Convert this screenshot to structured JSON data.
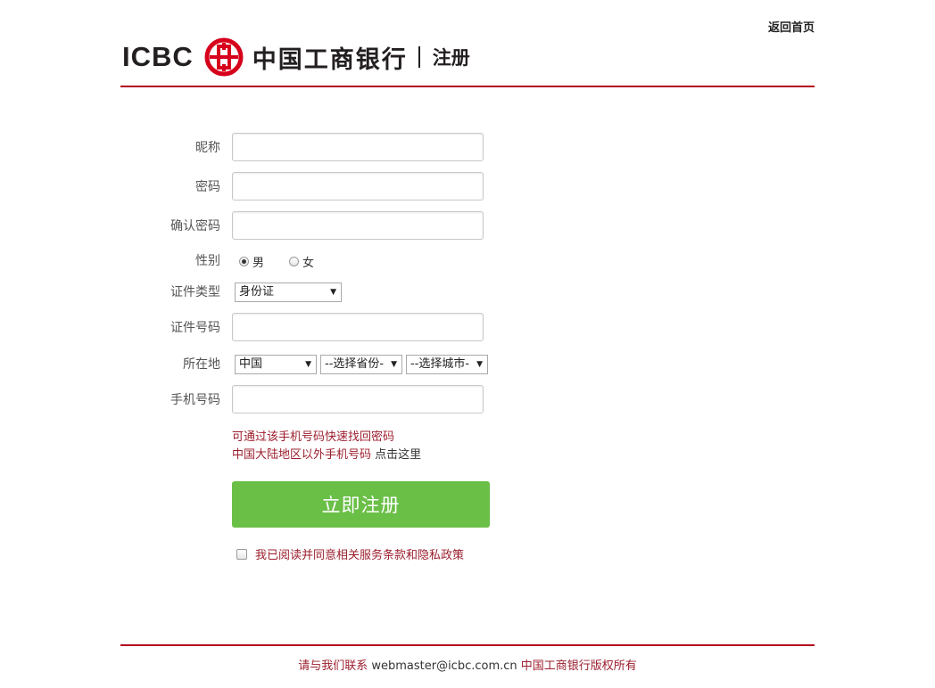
{
  "header": {
    "logo_en": "ICBC",
    "logo_cn": "中国工商银行",
    "page_title": "注册",
    "home_link": "返回首页",
    "brand_color": "#b3001b"
  },
  "form": {
    "nickname": {
      "label": "昵称",
      "value": ""
    },
    "password": {
      "label": "密码",
      "value": ""
    },
    "confirm_password": {
      "label": "确认密码",
      "value": ""
    },
    "gender": {
      "label": "性别",
      "options": [
        {
          "label": "男",
          "checked": true
        },
        {
          "label": "女",
          "checked": false
        }
      ]
    },
    "id_type": {
      "label": "证件类型",
      "selected": "身份证"
    },
    "id_number": {
      "label": "证件号码",
      "value": ""
    },
    "location": {
      "label": "所在地",
      "country": "中国",
      "province": "--选择省份-",
      "city": "--选择城市-"
    },
    "phone": {
      "label": "手机号码",
      "value": ""
    },
    "hint_line1": "可通过该手机号码快速找回密码",
    "hint_line2": "中国大陆地区以外手机号码",
    "hint_link": "点击这里",
    "submit_label": "立即注册",
    "submit_color": "#6abf47",
    "agree_label": "我已阅读并同意相关服务条款和隐私政策",
    "agree_checked": false
  },
  "footer": {
    "contact": "请与我们联系",
    "email": "webmaster@icbc.com.cn",
    "copyright": "中国工商银行版权所有"
  }
}
